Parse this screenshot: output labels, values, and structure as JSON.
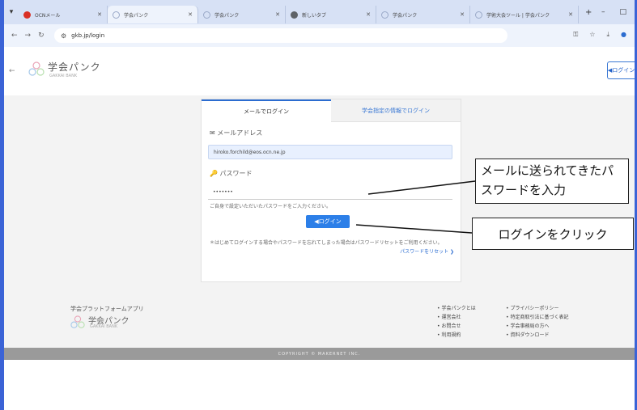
{
  "browser": {
    "tabs": [
      {
        "label": "OCNメール",
        "color": "#d93025",
        "active": false
      },
      {
        "label": "学会パンク",
        "color": "#9aa9c8",
        "active": true
      },
      {
        "label": "学会パンク",
        "color": "#9aa9c8",
        "active": false
      },
      {
        "label": "新しいタブ",
        "color": "#5f6368",
        "active": false
      },
      {
        "label": "学会パンク",
        "color": "#9aa9c8",
        "active": false
      },
      {
        "label": "学術大会ツール | 学会パンク",
        "color": "#9aa9c8",
        "active": false
      }
    ],
    "new_tab": "+",
    "minimize": "–",
    "maximize": "□",
    "url": "gkb.jp/login"
  },
  "header": {
    "logo_text": "学会パンク",
    "logo_sub": "GAKKAI BANK",
    "login_button": "◀ログイン"
  },
  "login": {
    "tab_email": "メールでログイン",
    "tab_society": "学会指定の情報でログイン",
    "email_label": "✉ メールアドレス",
    "email_value": "hiroko.forchild@eos.ocn.ne.jp",
    "password_label": "パスワード",
    "password_value": "•••••••",
    "password_hint": "ご自身で設定いただいたパスワードをご入力ください。",
    "submit": "◀ログイン",
    "note": "＊はじめてログインする場合やパスワードを忘れてしまった場合はパスワードリセットをご利用ください。",
    "reset_link": "パスワードをリセット ❯"
  },
  "annotations": {
    "password_callout": "メールに送られてきたパスワードを入力",
    "login_callout": "ログインをクリック"
  },
  "footer": {
    "title": "学会プラットフォームアプリ",
    "logo_text": "学会パンク",
    "logo_sub": "GAKKAI BANK",
    "col1": [
      "• 学会パンクとは",
      "• 運営会社",
      "• お問合せ",
      "• 利用規約"
    ],
    "col2": [
      "• プライバシーポリシー",
      "• 特定商取引法に基づく表記",
      "• 学会事務局の方へ",
      "• 資料ダウンロード"
    ],
    "copyright": "COPYRIGHT © MAKERNET INC."
  }
}
